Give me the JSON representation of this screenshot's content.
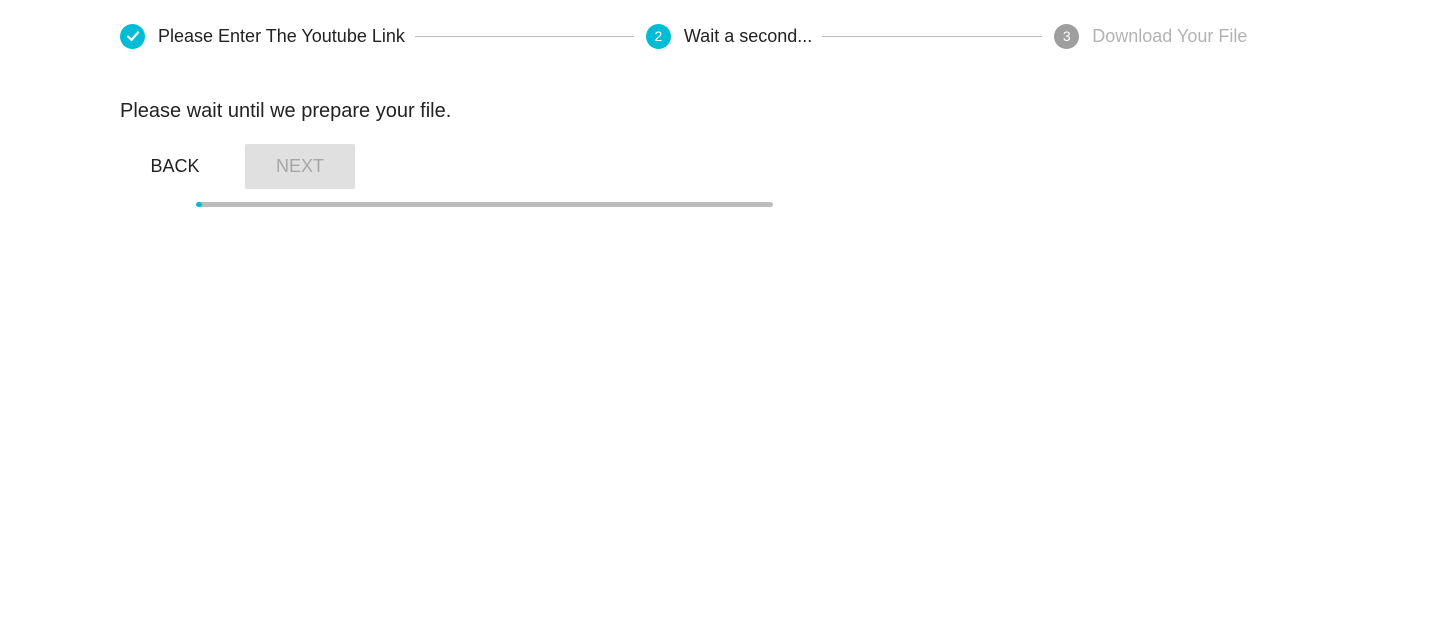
{
  "stepper": {
    "steps": [
      {
        "number": "",
        "label": "Please Enter The Youtube Link",
        "state": "completed",
        "icon": "check-icon"
      },
      {
        "number": "2",
        "label": "Wait a second...",
        "state": "active"
      },
      {
        "number": "3",
        "label": "Download Your File",
        "state": "inactive"
      }
    ]
  },
  "main": {
    "message": "Please wait until we prepare your file.",
    "back_label": "BACK",
    "next_label": "NEXT",
    "progress_fraction": 0.01
  },
  "colors": {
    "accent": "#00bcd4",
    "inactive_step": "#9e9e9e",
    "track": "#bdbdbd",
    "disabled_button_bg": "#e0e0e0",
    "disabled_button_text": "#a6a6a6"
  }
}
